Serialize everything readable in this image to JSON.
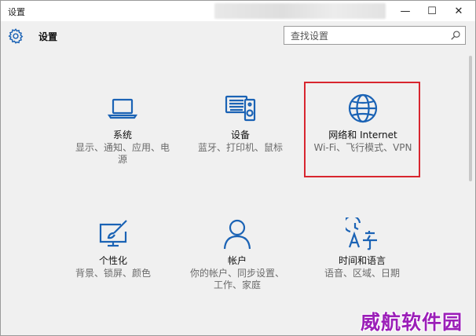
{
  "window": {
    "title": "设置",
    "controls": {
      "minimize": "—",
      "maximize": "☐",
      "close": "✕"
    }
  },
  "header": {
    "title": "设置",
    "search_placeholder": "查找设置"
  },
  "tiles": [
    {
      "name": "系统",
      "desc": "显示、通知、应用、电源",
      "icon": "laptop-icon"
    },
    {
      "name": "设备",
      "desc": "蓝牙、打印机、鼠标",
      "icon": "devices-icon"
    },
    {
      "name": "网络和 Internet",
      "desc": "Wi-Fi、飞行模式、VPN",
      "icon": "globe-icon"
    },
    {
      "name": "个性化",
      "desc": "背景、锁屏、颜色",
      "icon": "personalization-icon"
    },
    {
      "name": "帐户",
      "desc": "你的帐户、同步设置、工作、家庭",
      "icon": "person-icon"
    },
    {
      "name": "时间和语言",
      "desc": "语音、区域、日期",
      "icon": "time-language-icon"
    }
  ],
  "highlight_color": "#d8262f",
  "accent_color": "#1b63b5",
  "watermark": "威航软件园"
}
